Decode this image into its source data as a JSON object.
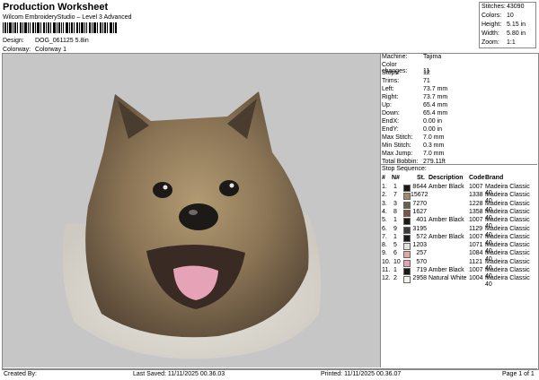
{
  "header": {
    "title": "Production Worksheet",
    "subtitle": "Wilcom EmbroideryStudio – Level 3 Advanced",
    "design_label": "Design:",
    "design_value": "DOG_061125 5.8in",
    "colorway_label": "Colorway:",
    "colorway_value": "Colorway 1"
  },
  "summary": [
    {
      "key": "Stitches:",
      "value": "43090"
    },
    {
      "key": "Colors:",
      "value": "10"
    },
    {
      "key": "Height:",
      "value": "5.15 in"
    },
    {
      "key": "Width:",
      "value": "5.80 in"
    },
    {
      "key": "Zoom:",
      "value": "1:1"
    }
  ],
  "machine_info": [
    {
      "key": "Machine:",
      "value": "Tajima"
    },
    {
      "key": "Color changes:",
      "value": "11"
    },
    {
      "key": "Stops:",
      "value": "12"
    },
    {
      "key": "Trims:",
      "value": "71"
    },
    {
      "key": "Left:",
      "value": "73.7 mm"
    },
    {
      "key": "Right:",
      "value": "73.7 mm"
    },
    {
      "key": "Up:",
      "value": "65.4 mm"
    },
    {
      "key": "Down:",
      "value": "65.4 mm"
    },
    {
      "key": "EndX:",
      "value": "0.00 in"
    },
    {
      "key": "EndY:",
      "value": "0.00 in"
    },
    {
      "key": "Max Stitch:",
      "value": "7.0 mm"
    },
    {
      "key": "Min Stitch:",
      "value": "0.3 mm"
    },
    {
      "key": "Max Jump:",
      "value": "7.0 mm"
    },
    {
      "key": "Total Bobbin:",
      "value": "279.11ft"
    }
  ],
  "stop_sequence": {
    "title": "Stop Sequence:",
    "headers": {
      "num": "#",
      "n": "N#",
      "st": "St.",
      "desc": "Description",
      "code": "Code",
      "brand": "Brand"
    },
    "rows": [
      {
        "num": "1.",
        "n": "1",
        "color": "#1c1a17",
        "st": "8644",
        "desc": "Amber Black",
        "code": "1007",
        "brand": "Madeira Classic 40"
      },
      {
        "num": "2.",
        "n": "7",
        "color": "#a08a6c",
        "st": "15672",
        "desc": "",
        "code": "1338",
        "brand": "Madeira Classic 40"
      },
      {
        "num": "3.",
        "n": "3",
        "color": "#6b5d50",
        "st": "7270",
        "desc": "",
        "code": "1228",
        "brand": "Madeira Classic 40"
      },
      {
        "num": "4.",
        "n": "8",
        "color": "#7a5448",
        "st": "1627",
        "desc": "",
        "code": "1358",
        "brand": "Madeira Classic 40"
      },
      {
        "num": "5.",
        "n": "1",
        "color": "#1c1a17",
        "st": "401",
        "desc": "Amber Black",
        "code": "1007",
        "brand": "Madeira Classic 40"
      },
      {
        "num": "6.",
        "n": "9",
        "color": "#3c3a3a",
        "st": "3195",
        "desc": "",
        "code": "1129",
        "brand": "Madeira Classic 40"
      },
      {
        "num": "7.",
        "n": "1",
        "color": "#1c1a17",
        "st": "572",
        "desc": "Amber Black",
        "code": "1007",
        "brand": "Madeira Classic 40"
      },
      {
        "num": "8.",
        "n": "5",
        "color": "#e2e2e2",
        "st": "1203",
        "desc": "",
        "code": "1071",
        "brand": "Madeira Classic 40"
      },
      {
        "num": "9.",
        "n": "6",
        "color": "#e2a8a0",
        "st": "257",
        "desc": "",
        "code": "1084",
        "brand": "Madeira Classic 40"
      },
      {
        "num": "10.",
        "n": "10",
        "color": "#e8a0b4",
        "st": "570",
        "desc": "",
        "code": "1121",
        "brand": "Madeira Classic 40"
      },
      {
        "num": "11.",
        "n": "1",
        "color": "#1c1a17",
        "st": "719",
        "desc": "Amber Black",
        "code": "1007",
        "brand": "Madeira Classic 40"
      },
      {
        "num": "12.",
        "n": "2",
        "color": "#f4f2ec",
        "st": "2958",
        "desc": "Natural White",
        "code": "1004",
        "brand": "Madeira Classic 40"
      }
    ]
  },
  "footer": {
    "created_by": "Created By:",
    "last_saved": "Last Saved: 11/11/2025 00.36.03",
    "printed": "Printed: 11/11/2025 00.36.07",
    "page": "Page 1 of 1"
  },
  "icons": {
    "barcode": "barcode-icon",
    "design": "dog-embroidery-image"
  }
}
